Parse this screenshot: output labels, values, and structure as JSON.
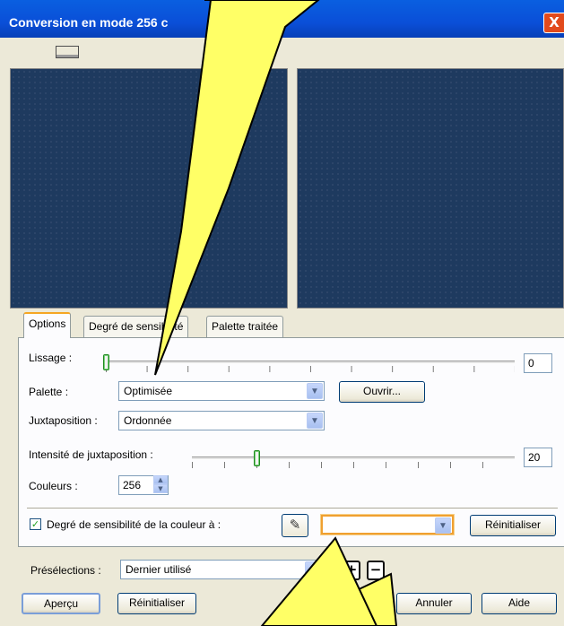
{
  "window": {
    "title": "Conversion en mode 256 c",
    "close_glyph": "X"
  },
  "tabs": [
    {
      "label": "Options",
      "active": true
    },
    {
      "label": "Degré de sensibilité",
      "active": false
    },
    {
      "label": "Palette traitée",
      "active": false
    }
  ],
  "options": {
    "lissage": {
      "label": "Lissage :",
      "value": "0",
      "level": 0
    },
    "palette": {
      "label": "Palette :",
      "value": "Optimisée",
      "open_button": "Ouvrir..."
    },
    "juxtaposition": {
      "label": "Juxtaposition :",
      "value": "Ordonnée"
    },
    "intensite": {
      "label": "Intensité de juxtaposition :",
      "value": "20",
      "level": 0.2
    },
    "couleurs": {
      "label": "Couleurs :",
      "value": "256"
    },
    "sensibilite": {
      "label": "Degré de sensibilité de la couleur à :",
      "checked": true,
      "checkmark": "✓",
      "combo_value": "",
      "reset_button": "Réinitialiser"
    }
  },
  "presets": {
    "label": "Présélections :",
    "value": "Dernier utilisé",
    "add": "+",
    "remove": "−"
  },
  "footer": {
    "apercu": "Aperçu",
    "reinitialiser": "Réinitialiser",
    "ok": "OK",
    "ok_visible": "K",
    "annuler": "Annuler",
    "aide": "Aide"
  },
  "icons": {
    "dropdown": "chevron-down-icon",
    "dropper": "eyedropper-icon",
    "preview_toggle": "preview-toggle-icon"
  },
  "colors": {
    "callout_fill": "#ffff66",
    "titlebar": "#0a4fd8",
    "preview_bg": "#1e3a5f"
  }
}
